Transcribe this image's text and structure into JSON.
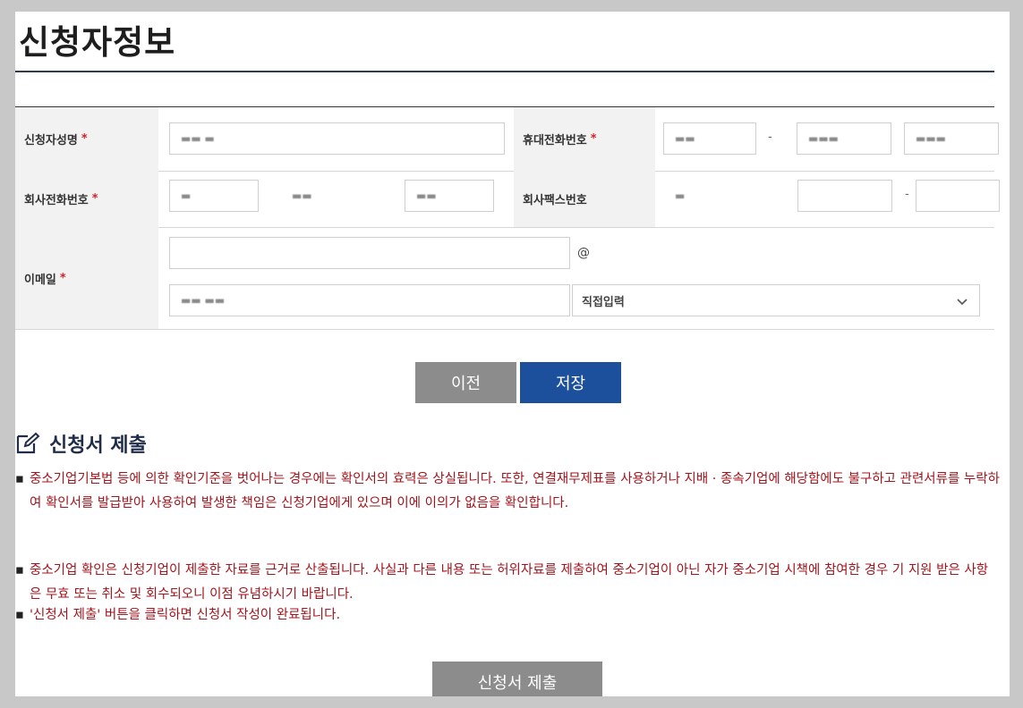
{
  "page": {
    "title": "신청자정보"
  },
  "form": {
    "applicant_name": {
      "label": "신청자성명",
      "required_mark": "*",
      "value": "▬▬ ▬"
    },
    "mobile": {
      "label": "휴대전화번호",
      "required_mark": "*",
      "part1": "▬▬",
      "part2": "▬▬▬",
      "part3": "▬▬▬",
      "sep": "-"
    },
    "company_phone": {
      "label": "회사전화번호",
      "required_mark": "*",
      "part1": "▬",
      "part2": "▬▬",
      "part3": "▬▬"
    },
    "company_fax": {
      "label": "회사팩스번호",
      "part1": "▬",
      "sep": "-"
    },
    "email": {
      "label": "이메일",
      "required_mark": "*",
      "id_value": "",
      "at": "@",
      "domain_value": "▬▬ ▬▬",
      "domain_select": "직접입력"
    }
  },
  "buttons": {
    "prev": "이전",
    "save": "저장",
    "submit": "신청서 제출"
  },
  "section": {
    "title": "신청서 제출"
  },
  "notices": [
    "중소기업기본법 등에 의한 확인기준을 벗어나는 경우에는 확인서의 효력은 상실됩니다. 또한, 연결재무제표를 사용하거나 지배 · 종속기업에 해당함에도 불구하고 관련서류를 누락하여 확인서를 발급받아 사용하여 발생한 책임은 신청기업에게 있으며 이에 이의가 없음을 확인합니다.",
    "중소기업 확인은 신청기업이 제출한 자료를 근거로 산출됩니다. 사실과 다른 내용 또는 허위자료를 제출하여 중소기업이 아닌 자가 중소기업 시책에 참여한 경우 기 지원 받은 사항은 무효 또는 취소 및 회수되오니 이점 유념하시기 바랍니다.",
    "'신청서 제출' 버튼을 클릭하면 신청서 작성이 완료됩니다."
  ],
  "bullet_char": "▪",
  "colors": {
    "save": "#1c4f9c",
    "prev": "#8c8c8c",
    "notice": "#a3141c",
    "required": "#d2232a"
  }
}
